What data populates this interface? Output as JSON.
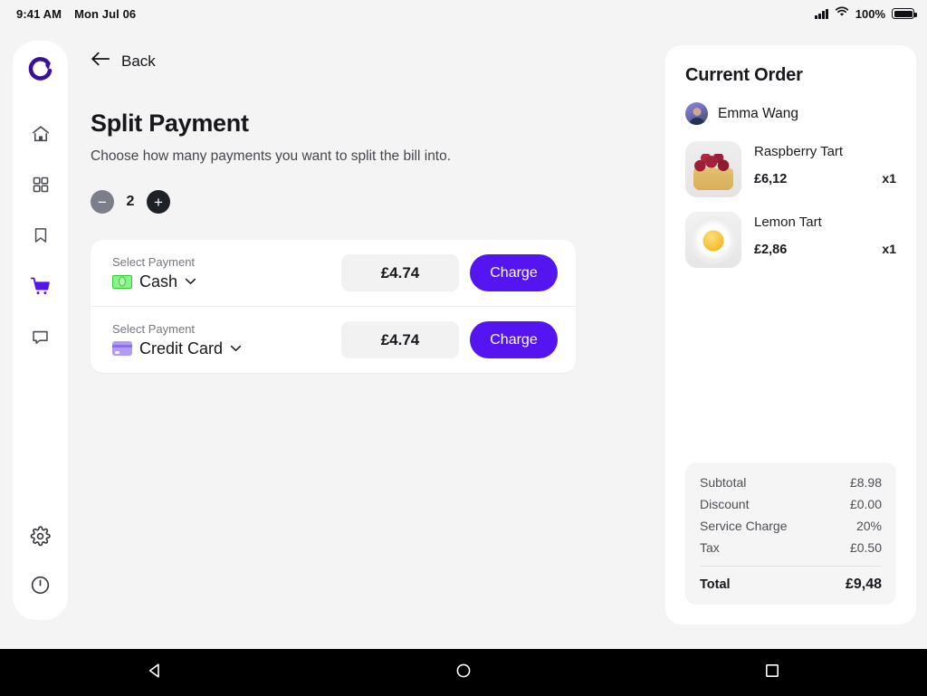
{
  "statusbar": {
    "time": "9:41 AM",
    "date": "Mon Jul 06",
    "battery_percent": "100%",
    "signal_icon": "cellular-signal-icon",
    "wifi_icon": "wifi-icon",
    "battery_icon": "battery-full-icon"
  },
  "sidebar": {
    "logo_name": "app-logo",
    "items": [
      {
        "icon": "home-icon",
        "name": "home",
        "active": false
      },
      {
        "icon": "grid-icon",
        "name": "dashboard",
        "active": false
      },
      {
        "icon": "bookmark-icon",
        "name": "bookmarks",
        "active": false
      },
      {
        "icon": "cart-icon",
        "name": "orders",
        "active": true
      },
      {
        "icon": "chat-icon",
        "name": "messages",
        "active": false
      }
    ],
    "bottom_items": [
      {
        "icon": "gear-icon",
        "name": "settings"
      },
      {
        "icon": "power-icon",
        "name": "logout"
      }
    ]
  },
  "main": {
    "back_label": "Back",
    "back_icon": "arrow-left-icon",
    "title": "Split Payment",
    "subtitle": "Choose how many payments you want to split the bill into.",
    "stepper": {
      "minus_label": "−",
      "value": "2",
      "plus_label": "+"
    },
    "payments": [
      {
        "caption": "Select Payment",
        "method": "Cash",
        "method_icon": "banknote-icon",
        "amount": "£4.74",
        "charge_label": "Charge"
      },
      {
        "caption": "Select Payment",
        "method": "Credit Card",
        "method_icon": "credit-card-icon",
        "amount": "£4.74",
        "charge_label": "Charge"
      }
    ]
  },
  "order": {
    "title": "Current Order",
    "customer": "Emma Wang",
    "items": [
      {
        "name": "Raspberry Tart",
        "price": "£6,12",
        "qty": "x1",
        "thumb": "raspberry-tart-photo"
      },
      {
        "name": "Lemon Tart",
        "price": "£2,86",
        "qty": "x1",
        "thumb": "lemon-tart-photo"
      }
    ],
    "totals": [
      {
        "label": "Subtotal",
        "value": "£8.98"
      },
      {
        "label": "Discount",
        "value": "£0.00"
      },
      {
        "label": "Service Charge",
        "value": "20%"
      },
      {
        "label": "Tax",
        "value": "£0.50"
      }
    ],
    "total": {
      "label": "Total",
      "value": "£9,48"
    }
  },
  "androidnav": {
    "back_icon": "triangle-back-icon",
    "home_icon": "circle-home-icon",
    "recents_icon": "square-recents-icon"
  },
  "colors": {
    "accent": "#5415f0",
    "logo": "#3b1199",
    "page_bg": "#f4f4f5",
    "text": "#17181c",
    "muted": "#76787f"
  }
}
